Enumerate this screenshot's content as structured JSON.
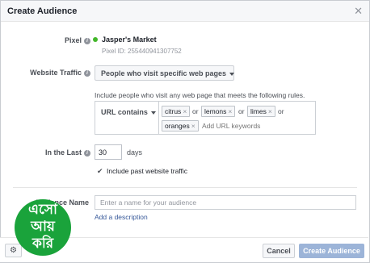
{
  "dialog": {
    "title": "Create Audience",
    "close_icon": "close-icon"
  },
  "pixel": {
    "label": "Pixel",
    "status_color": "#42b72a",
    "name": "Jasper's Market",
    "id_text": "Pixel ID: 255440941307752"
  },
  "website_traffic": {
    "label": "Website Traffic",
    "selected": "People who visit specific web pages",
    "include_text": "Include people who visit any web page that meets the following rules.",
    "rule_operator": "URL contains",
    "keywords": [
      "citrus",
      "lemons",
      "limes",
      "oranges"
    ],
    "or_label": "or",
    "keyword_placeholder": "Add URL keywords"
  },
  "in_the_last": {
    "label": "In the Last",
    "value": "30",
    "unit": "days",
    "include_past_checked": true,
    "include_past_label": "Include past website traffic"
  },
  "audience_name": {
    "label": "Audience Name",
    "placeholder": "Enter a name for your audience",
    "add_description": "Add a description"
  },
  "footer": {
    "settings_icon": "gear-icon",
    "cancel_label": "Cancel",
    "create_label": "Create Audience"
  },
  "badge": {
    "lines": [
      "এসো",
      "আয়",
      "করি"
    ],
    "color": "#1aa33b"
  },
  "colors": {
    "link": "#365899",
    "primary_disabled": "#9cb4d8"
  }
}
